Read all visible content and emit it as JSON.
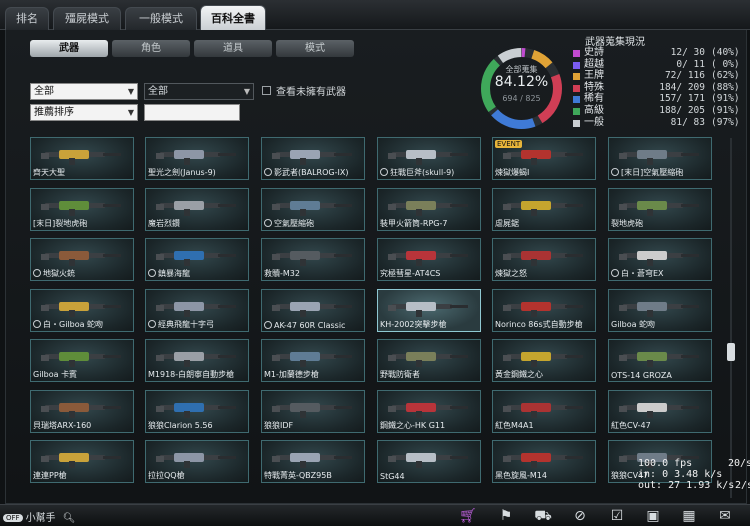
{
  "top_tabs": [
    "排名",
    "殭屍模式",
    "一般模式",
    "百科全書"
  ],
  "sub_tabs": [
    "武器",
    "角色",
    "道具",
    "模式"
  ],
  "filters": {
    "select1": "全部",
    "select2": "全部",
    "select3": "推薦排序",
    "check_label": "查看未擁有武器"
  },
  "collection": {
    "title": "全部蒐集",
    "percent": "84.12%",
    "count": "694 / 825",
    "stats_title": "武器蒐集現況",
    "rows": [
      {
        "name": "史詩",
        "count": "12/ 30",
        "pct": "(40%)",
        "color": "#c14ad0"
      },
      {
        "name": "超越",
        "count": "0/ 11",
        "pct": "( 0%)",
        "color": "#7a5cf0"
      },
      {
        "name": "王牌",
        "count": "72/ 116",
        "pct": "(62%)",
        "color": "#e0a336"
      },
      {
        "name": "特殊",
        "count": "184/ 209",
        "pct": "(88%)",
        "color": "#d03e55"
      },
      {
        "name": "稀有",
        "count": "157/ 171",
        "pct": "(91%)",
        "color": "#3f7ad6"
      },
      {
        "name": "高級",
        "count": "188/ 205",
        "pct": "(91%)",
        "color": "#3fa85a"
      },
      {
        "name": "一般",
        "count": "81/ 83",
        "pct": "(97%)",
        "color": "#c9ced2"
      }
    ]
  },
  "weapons": [
    {
      "name": "齊天大聖",
      "lock": false,
      "badge": ""
    },
    {
      "name": "聖光之劍(Janus-9)",
      "lock": false,
      "badge": ""
    },
    {
      "name": "影武者(BALROG-IX)",
      "lock": true,
      "badge": ""
    },
    {
      "name": "狂戰巨斧(skull-9)",
      "lock": true,
      "badge": ""
    },
    {
      "name": "煉獄爆蝎I",
      "lock": false,
      "badge": "EVENT"
    },
    {
      "name": "[末日]空氣壓縮砲",
      "lock": true,
      "badge": ""
    },
    {
      "name": "[末日]裂地虎砲",
      "lock": false,
      "badge": ""
    },
    {
      "name": "魔岩烈鑽",
      "lock": false,
      "badge": ""
    },
    {
      "name": "空氣壓縮砲",
      "lock": true,
      "badge": ""
    },
    {
      "name": "裝甲火箭筒-RPG-7",
      "lock": false,
      "badge": ""
    },
    {
      "name": "虐屍鋸",
      "lock": false,
      "badge": ""
    },
    {
      "name": "裂地虎砲",
      "lock": false,
      "badge": ""
    },
    {
      "name": "地獄火銃",
      "lock": true,
      "badge": ""
    },
    {
      "name": "鎮暴海龍",
      "lock": true,
      "badge": ""
    },
    {
      "name": "救贖-M32",
      "lock": false,
      "badge": ""
    },
    {
      "name": "究極彗星-AT4CS",
      "lock": false,
      "badge": ""
    },
    {
      "name": "煉獄之怒",
      "lock": false,
      "badge": ""
    },
    {
      "name": "白・蒼穹EX",
      "lock": true,
      "badge": ""
    },
    {
      "name": "白・Gilboa 蛇吻",
      "lock": true,
      "badge": ""
    },
    {
      "name": "經典飛龍十字弓",
      "lock": true,
      "badge": ""
    },
    {
      "name": "AK-47 60R Classic",
      "lock": true,
      "badge": ""
    },
    {
      "name": "KH-2002突擊步槍",
      "lock": false,
      "badge": ""
    },
    {
      "name": "Norinco 86s式自動步槍",
      "lock": false,
      "badge": ""
    },
    {
      "name": "Gilboa 蛇吻",
      "lock": false,
      "badge": ""
    },
    {
      "name": "Gilboa 卡賓",
      "lock": false,
      "badge": ""
    },
    {
      "name": "M1918-白朗寧自動步槍",
      "lock": false,
      "badge": ""
    },
    {
      "name": "M1-加蘭德步槍",
      "lock": false,
      "badge": ""
    },
    {
      "name": "野戰防衛者",
      "lock": false,
      "badge": ""
    },
    {
      "name": "黃金鋼鐵之心",
      "lock": false,
      "badge": ""
    },
    {
      "name": "OTS-14 GROZA",
      "lock": false,
      "badge": ""
    },
    {
      "name": "貝瑞塔ARX-160",
      "lock": false,
      "badge": ""
    },
    {
      "name": "狼狼Clarion 5.56",
      "lock": false,
      "badge": ""
    },
    {
      "name": "狼狼IDF",
      "lock": false,
      "badge": ""
    },
    {
      "name": "鋼鐵之心-HK G11",
      "lock": false,
      "badge": ""
    },
    {
      "name": "紅色M4A1",
      "lock": false,
      "badge": ""
    },
    {
      "name": "紅色CV-47",
      "lock": false,
      "badge": ""
    },
    {
      "name": "連連PP槍",
      "lock": false,
      "badge": ""
    },
    {
      "name": "拉拉QQ槍",
      "lock": false,
      "badge": ""
    },
    {
      "name": "特戰菁英-QBZ95B",
      "lock": false,
      "badge": ""
    },
    {
      "name": "StG44",
      "lock": false,
      "badge": ""
    },
    {
      "name": "黑色旋風-M14",
      "lock": false,
      "badge": ""
    },
    {
      "name": "狼狼CV47",
      "lock": false,
      "badge": ""
    }
  ],
  "overlay": {
    "fps": "100.0 fps",
    "right1": "20/s",
    "in": "in:  0 3.48 k/s",
    "out": "out: 27 1.93 k/s",
    "right2": "2/s"
  },
  "bottom": {
    "helper_pill": "OFF",
    "helper": "小幫手"
  }
}
